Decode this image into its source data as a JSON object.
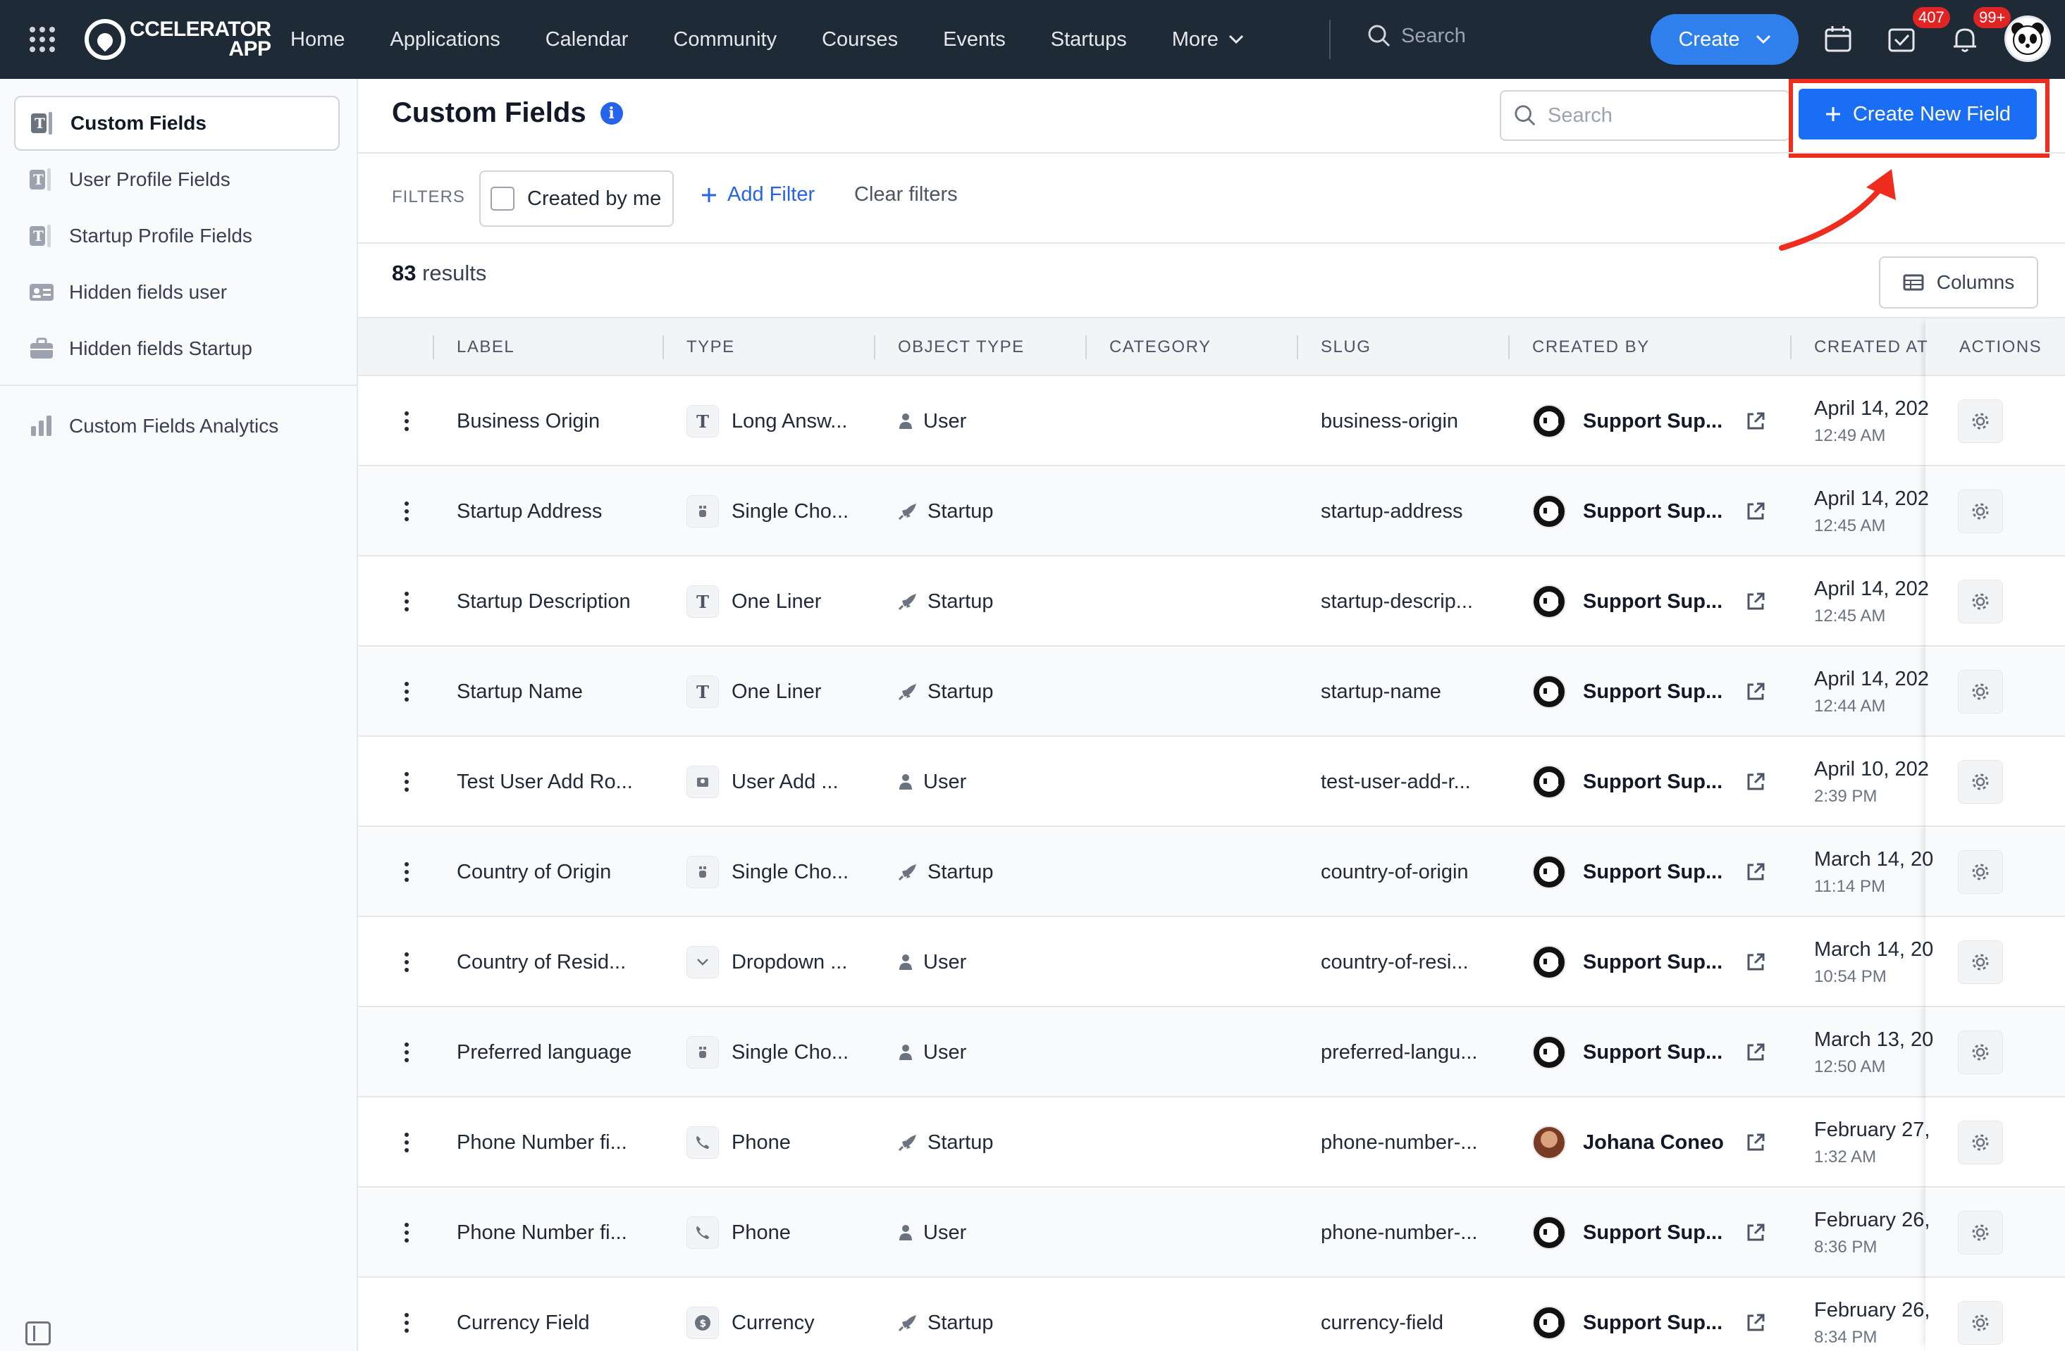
{
  "topnav": {
    "logo_line1": "CCELERATOR",
    "logo_line2": "APP",
    "items": [
      "Home",
      "Applications",
      "Calendar",
      "Community",
      "Courses",
      "Events",
      "Startups",
      "More"
    ],
    "search_placeholder": "Search",
    "create_label": "Create",
    "tasks_badge": "407",
    "notifications_badge": "99+"
  },
  "sidebar": {
    "items": [
      {
        "label": "Custom Fields",
        "icon": "text-field-icon",
        "active": true
      },
      {
        "label": "User Profile Fields",
        "icon": "text-field-icon",
        "active": false
      },
      {
        "label": "Startup Profile Fields",
        "icon": "text-field-icon",
        "active": false
      },
      {
        "label": "Hidden fields user",
        "icon": "id-card-icon",
        "active": false
      },
      {
        "label": "Hidden fields Startup",
        "icon": "briefcase-icon",
        "active": false
      }
    ],
    "analytics_label": "Custom Fields Analytics"
  },
  "main": {
    "title": "Custom Fields",
    "search_placeholder": "Search",
    "create_new_field_label": "Create New Field",
    "filters_label": "FILTERS",
    "created_by_me_label": "Created by me",
    "add_filter_label": "Add Filter",
    "clear_filters_label": "Clear filters",
    "results_count": "83",
    "results_suffix": "results",
    "columns_label": "Columns"
  },
  "table": {
    "headers": [
      "LABEL",
      "TYPE",
      "OBJECT TYPE",
      "CATEGORY",
      "SLUG",
      "CREATED BY",
      "CREATED AT",
      "ACTIONS"
    ],
    "rows": [
      {
        "label": "Business Origin",
        "type": "Long Answ...",
        "type_icon": "T",
        "object_type": "User",
        "category": "",
        "slug": "business-origin",
        "created_by": "Support Sup...",
        "avatar": "panda",
        "date": "April 14, 202",
        "time": "12:49 AM"
      },
      {
        "label": "Startup Address",
        "type": "Single Cho...",
        "type_icon": "choice",
        "object_type": "Startup",
        "category": "",
        "slug": "startup-address",
        "created_by": "Support Sup...",
        "avatar": "panda",
        "date": "April 14, 202",
        "time": "12:45 AM"
      },
      {
        "label": "Startup Description",
        "type": "One Liner",
        "type_icon": "T",
        "object_type": "Startup",
        "category": "",
        "slug": "startup-descrip...",
        "created_by": "Support Sup...",
        "avatar": "panda",
        "date": "April 14, 202",
        "time": "12:45 AM"
      },
      {
        "label": "Startup Name",
        "type": "One Liner",
        "type_icon": "T",
        "object_type": "Startup",
        "category": "",
        "slug": "startup-name",
        "created_by": "Support Sup...",
        "avatar": "panda",
        "date": "April 14, 202",
        "time": "12:44 AM"
      },
      {
        "label": "Test User Add Ro...",
        "type": "User Add ...",
        "type_icon": "user-add",
        "object_type": "User",
        "category": "",
        "slug": "test-user-add-r...",
        "created_by": "Support Sup...",
        "avatar": "panda",
        "date": "April 10, 202",
        "time": "2:39 PM"
      },
      {
        "label": "Country of Origin",
        "type": "Single Cho...",
        "type_icon": "choice",
        "object_type": "Startup",
        "category": "",
        "slug": "country-of-origin",
        "created_by": "Support Sup...",
        "avatar": "panda",
        "date": "March 14, 20",
        "time": "11:14 PM"
      },
      {
        "label": "Country of Resid...",
        "type": "Dropdown ...",
        "type_icon": "chevron",
        "object_type": "User",
        "category": "",
        "slug": "country-of-resi...",
        "created_by": "Support Sup...",
        "avatar": "panda",
        "date": "March 14, 20",
        "time": "10:54 PM"
      },
      {
        "label": "Preferred language",
        "type": "Single Cho...",
        "type_icon": "choice",
        "object_type": "User",
        "category": "",
        "slug": "preferred-langu...",
        "created_by": "Support Sup...",
        "avatar": "panda",
        "date": "March 13, 20",
        "time": "12:50 AM"
      },
      {
        "label": "Phone Number fi...",
        "type": "Phone",
        "type_icon": "phone",
        "object_type": "Startup",
        "category": "",
        "slug": "phone-number-...",
        "created_by": "Johana Coneo",
        "avatar": "photo",
        "date": "February 27,",
        "time": "1:32 AM"
      },
      {
        "label": "Phone Number fi...",
        "type": "Phone",
        "type_icon": "phone",
        "object_type": "User",
        "category": "",
        "slug": "phone-number-...",
        "created_by": "Support Sup...",
        "avatar": "panda",
        "date": "February 26,",
        "time": "8:36 PM"
      },
      {
        "label": "Currency Field",
        "type": "Currency",
        "type_icon": "currency",
        "object_type": "Startup",
        "category": "",
        "slug": "currency-field",
        "created_by": "Support Sup...",
        "avatar": "panda",
        "date": "February 26,",
        "time": "8:34 PM"
      }
    ]
  },
  "colors": {
    "nav_bg": "#1f2a37",
    "primary": "#1a6ef5",
    "highlight": "#ef2d1f",
    "badge": "#e02424"
  }
}
